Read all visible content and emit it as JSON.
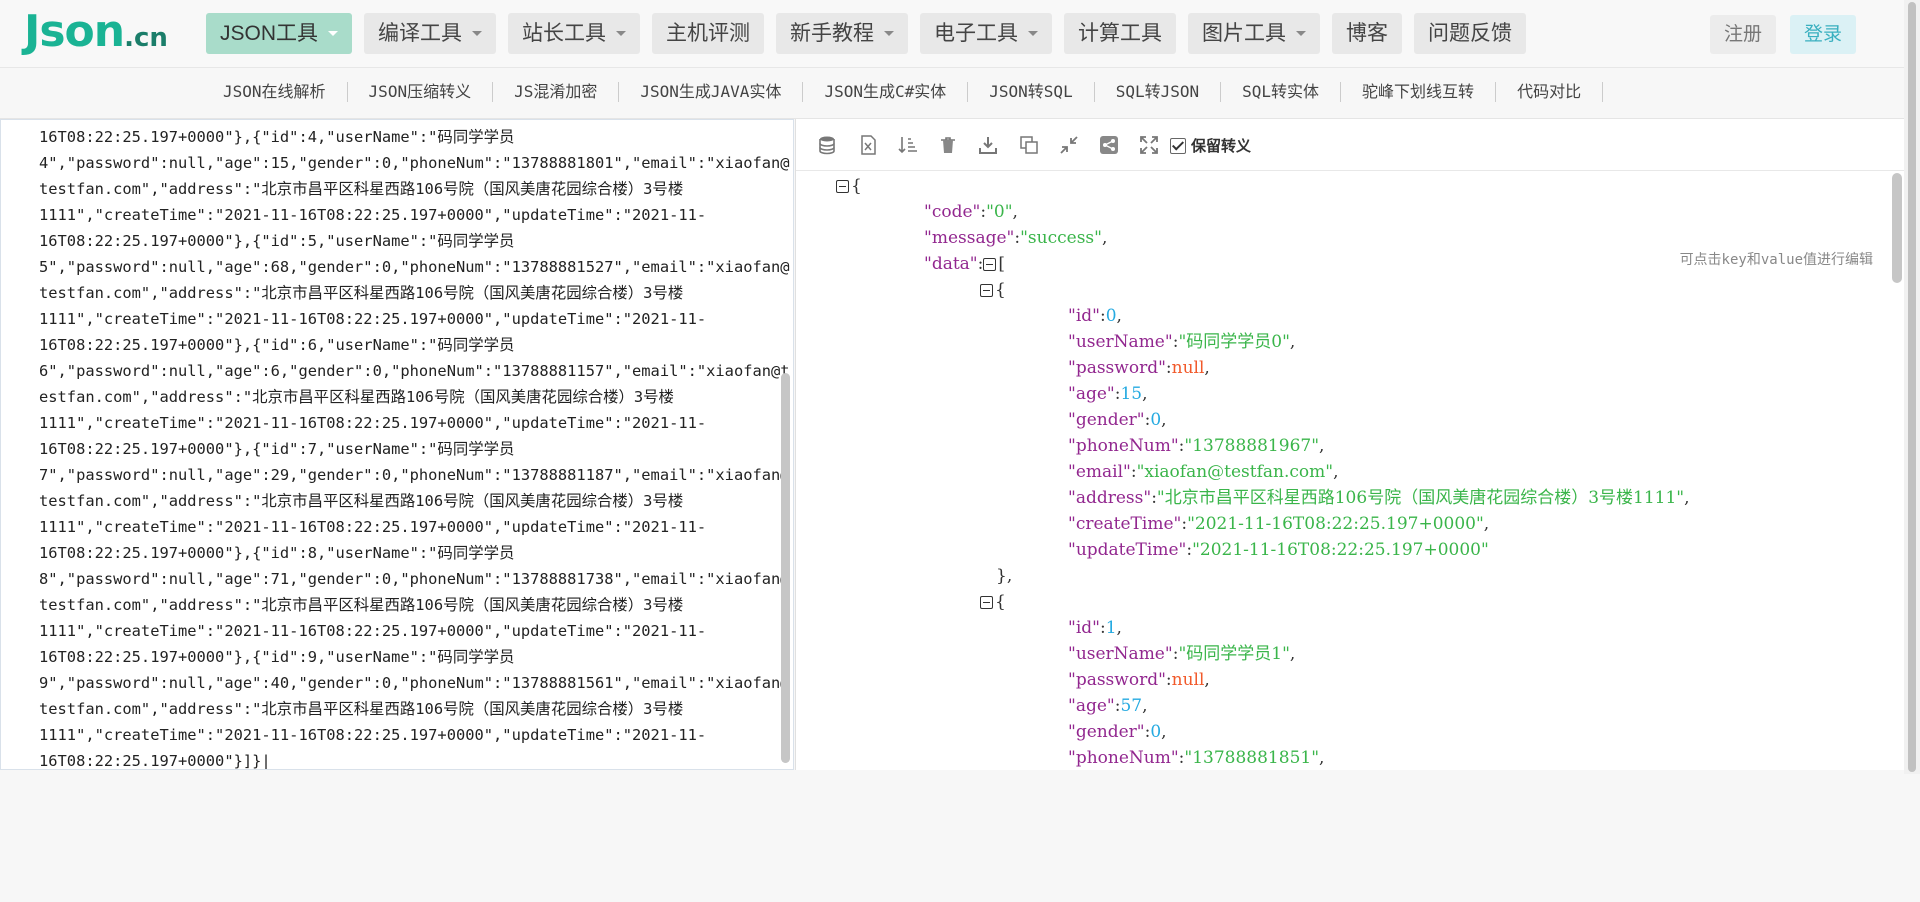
{
  "logo": {
    "main": "Json",
    "suffix": ".cn"
  },
  "nav": {
    "items": [
      {
        "label": "JSON工具",
        "dropdown": true,
        "active": true
      },
      {
        "label": "编译工具",
        "dropdown": true
      },
      {
        "label": "站长工具",
        "dropdown": true
      },
      {
        "label": "主机评测",
        "dropdown": false
      },
      {
        "label": "新手教程",
        "dropdown": true
      },
      {
        "label": "电子工具",
        "dropdown": true
      },
      {
        "label": "计算工具",
        "dropdown": false
      },
      {
        "label": "图片工具",
        "dropdown": true
      },
      {
        "label": "博客",
        "dropdown": false
      },
      {
        "label": "问题反馈",
        "dropdown": false
      }
    ],
    "register": "注册",
    "login": "登录"
  },
  "subnav": {
    "items": [
      "JSON在线解析",
      "JSON压缩转义",
      "JS混淆加密",
      "JSON生成JAVA实体",
      "JSON生成C#实体",
      "JSON转SQL",
      "SQL转JSON",
      "SQL转实体",
      "驼峰下划线互转",
      "代码对比"
    ]
  },
  "left_editor": {
    "lines": [
      "16T08:22:25.197+0000\"},{\"id\":4,\"userName\":\"码同学学员",
      "4\",\"password\":null,\"age\":15,\"gender\":0,\"phoneNum\":\"13788881801\",\"email\":\"xiaofan@",
      "testfan.com\",\"address\":\"北京市昌平区科星西路106号院（国风美唐花园综合楼）3号楼",
      "1111\",\"createTime\":\"2021-11-16T08:22:25.197+0000\",\"updateTime\":\"2021-11-",
      "16T08:22:25.197+0000\"},{\"id\":5,\"userName\":\"码同学学员",
      "5\",\"password\":null,\"age\":68,\"gender\":0,\"phoneNum\":\"13788881527\",\"email\":\"xiaofan@",
      "testfan.com\",\"address\":\"北京市昌平区科星西路106号院（国风美唐花园综合楼）3号楼",
      "1111\",\"createTime\":\"2021-11-16T08:22:25.197+0000\",\"updateTime\":\"2021-11-",
      "16T08:22:25.197+0000\"},{\"id\":6,\"userName\":\"码同学学员",
      "6\",\"password\":null,\"age\":6,\"gender\":0,\"phoneNum\":\"13788881157\",\"email\":\"xiaofan@t",
      "estfan.com\",\"address\":\"北京市昌平区科星西路106号院（国风美唐花园综合楼）3号楼",
      "1111\",\"createTime\":\"2021-11-16T08:22:25.197+0000\",\"updateTime\":\"2021-11-",
      "16T08:22:25.197+0000\"},{\"id\":7,\"userName\":\"码同学学员",
      "7\",\"password\":null,\"age\":29,\"gender\":0,\"phoneNum\":\"13788881187\",\"email\":\"xiaofan@",
      "testfan.com\",\"address\":\"北京市昌平区科星西路106号院（国风美唐花园综合楼）3号楼",
      "1111\",\"createTime\":\"2021-11-16T08:22:25.197+0000\",\"updateTime\":\"2021-11-",
      "16T08:22:25.197+0000\"},{\"id\":8,\"userName\":\"码同学学员",
      "8\",\"password\":null,\"age\":71,\"gender\":0,\"phoneNum\":\"13788881738\",\"email\":\"xiaofan@",
      "testfan.com\",\"address\":\"北京市昌平区科星西路106号院（国风美唐花园综合楼）3号楼",
      "1111\",\"createTime\":\"2021-11-16T08:22:25.197+0000\",\"updateTime\":\"2021-11-",
      "16T08:22:25.197+0000\"},{\"id\":9,\"userName\":\"码同学学员",
      "9\",\"password\":null,\"age\":40,\"gender\":0,\"phoneNum\":\"13788881561\",\"email\":\"xiaofan@",
      "testfan.com\",\"address\":\"北京市昌平区科星西路106号院（国风美唐花园综合楼）3号楼",
      "1111\",\"createTime\":\"2021-11-16T08:22:25.197+0000\",\"updateTime\":\"2021-11-",
      "16T08:22:25.197+0000\"}]}|"
    ]
  },
  "toolbar": {
    "icons": [
      "database-icon",
      "excel-icon",
      "sort-icon",
      "trash-icon",
      "download-icon",
      "copy-icon",
      "compress-icon",
      "share-icon",
      "fullscreen-icon"
    ],
    "keep_escape_label": "保留转义",
    "keep_escape_checked": true
  },
  "viewer": {
    "hint": "可点击key和value值进行编辑",
    "tree_lines": [
      {
        "indent": 0,
        "fold": true,
        "parts": [
          [
            "p",
            "{"
          ]
        ]
      },
      {
        "indent": 1,
        "parts": [
          [
            "k",
            "\"code\""
          ],
          [
            "p",
            ":"
          ],
          [
            "s",
            "\"0\""
          ],
          [
            "p",
            ","
          ]
        ]
      },
      {
        "indent": 1,
        "parts": [
          [
            "k",
            "\"message\""
          ],
          [
            "p",
            ":"
          ],
          [
            "s",
            "\"success\""
          ],
          [
            "p",
            ","
          ]
        ]
      },
      {
        "indent": 1,
        "fold_after_key": true,
        "parts": [
          [
            "k",
            "\"data\""
          ],
          [
            "p",
            ":"
          ],
          [
            "fold",
            ""
          ],
          [
            "p",
            "["
          ]
        ]
      },
      {
        "indent": 2,
        "fold": true,
        "parts": [
          [
            "p",
            "{"
          ]
        ]
      },
      {
        "indent": 3,
        "parts": [
          [
            "k",
            "\"id\""
          ],
          [
            "p",
            ":"
          ],
          [
            "n",
            "0"
          ],
          [
            "p",
            ","
          ]
        ]
      },
      {
        "indent": 3,
        "parts": [
          [
            "k",
            "\"userName\""
          ],
          [
            "p",
            ":"
          ],
          [
            "s",
            "\"码同学学员0\""
          ],
          [
            "p",
            ","
          ]
        ]
      },
      {
        "indent": 3,
        "parts": [
          [
            "k",
            "\"password\""
          ],
          [
            "p",
            ":"
          ],
          [
            "nl",
            "null"
          ],
          [
            "p",
            ","
          ]
        ]
      },
      {
        "indent": 3,
        "parts": [
          [
            "k",
            "\"age\""
          ],
          [
            "p",
            ":"
          ],
          [
            "n",
            "15"
          ],
          [
            "p",
            ","
          ]
        ]
      },
      {
        "indent": 3,
        "parts": [
          [
            "k",
            "\"gender\""
          ],
          [
            "p",
            ":"
          ],
          [
            "n",
            "0"
          ],
          [
            "p",
            ","
          ]
        ]
      },
      {
        "indent": 3,
        "parts": [
          [
            "k",
            "\"phoneNum\""
          ],
          [
            "p",
            ":"
          ],
          [
            "s",
            "\"13788881967\""
          ],
          [
            "p",
            ","
          ]
        ]
      },
      {
        "indent": 3,
        "parts": [
          [
            "k",
            "\"email\""
          ],
          [
            "p",
            ":"
          ],
          [
            "s",
            "\"xiaofan@testfan.com\""
          ],
          [
            "p",
            ","
          ]
        ]
      },
      {
        "indent": 3,
        "parts": [
          [
            "k",
            "\"address\""
          ],
          [
            "p",
            ":"
          ],
          [
            "s",
            "\"北京市昌平区科星西路106号院（国风美唐花园综合楼）3号楼1111\""
          ],
          [
            "p",
            ","
          ]
        ]
      },
      {
        "indent": 3,
        "parts": [
          [
            "k",
            "\"createTime\""
          ],
          [
            "p",
            ":"
          ],
          [
            "s",
            "\"2021-11-16T08:22:25.197+0000\""
          ],
          [
            "p",
            ","
          ]
        ]
      },
      {
        "indent": 3,
        "parts": [
          [
            "k",
            "\"updateTime\""
          ],
          [
            "p",
            ":"
          ],
          [
            "s",
            "\"2021-11-16T08:22:25.197+0000\""
          ]
        ]
      },
      {
        "indent": 2,
        "parts": [
          [
            "p",
            "},"
          ]
        ]
      },
      {
        "indent": 2,
        "fold": true,
        "parts": [
          [
            "p",
            "{"
          ]
        ]
      },
      {
        "indent": 3,
        "parts": [
          [
            "k",
            "\"id\""
          ],
          [
            "p",
            ":"
          ],
          [
            "n",
            "1"
          ],
          [
            "p",
            ","
          ]
        ]
      },
      {
        "indent": 3,
        "parts": [
          [
            "k",
            "\"userName\""
          ],
          [
            "p",
            ":"
          ],
          [
            "s",
            "\"码同学学员1\""
          ],
          [
            "p",
            ","
          ]
        ]
      },
      {
        "indent": 3,
        "parts": [
          [
            "k",
            "\"password\""
          ],
          [
            "p",
            ":"
          ],
          [
            "nl",
            "null"
          ],
          [
            "p",
            ","
          ]
        ]
      },
      {
        "indent": 3,
        "parts": [
          [
            "k",
            "\"age\""
          ],
          [
            "p",
            ":"
          ],
          [
            "n",
            "57"
          ],
          [
            "p",
            ","
          ]
        ]
      },
      {
        "indent": 3,
        "parts": [
          [
            "k",
            "\"gender\""
          ],
          [
            "p",
            ":"
          ],
          [
            "n",
            "0"
          ],
          [
            "p",
            ","
          ]
        ]
      },
      {
        "indent": 3,
        "parts": [
          [
            "k",
            "\"phoneNum\""
          ],
          [
            "p",
            ":"
          ],
          [
            "s",
            "\"13788881851\""
          ],
          [
            "p",
            ","
          ]
        ]
      }
    ]
  },
  "colors": {
    "brand": "#1ab394",
    "active_nav": "#a9dcca",
    "json_key": "#92278f",
    "json_string": "#3ab54a",
    "json_number": "#25aae1",
    "json_null": "#f1592a"
  }
}
